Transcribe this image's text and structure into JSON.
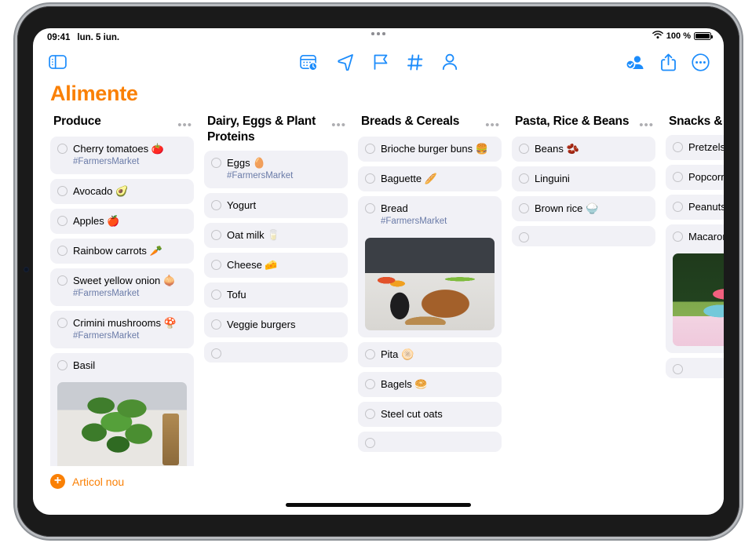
{
  "status_bar": {
    "time": "09:41",
    "date": "lun. 5 iun.",
    "wifi_icon": "wifi-icon",
    "battery_percent": "100 %"
  },
  "toolbar": {
    "sidebar_toggle": "sidebar-toggle-icon",
    "center_icons": [
      "calendar-clock-icon",
      "navigation-arrow-icon",
      "flag-icon",
      "hashtag-icon",
      "person-icon"
    ],
    "right_icons": [
      "add-collaborator-icon",
      "share-icon",
      "more-options-icon"
    ]
  },
  "header": {
    "title": "Alimente"
  },
  "board": {
    "columns": [
      {
        "title": "Produce",
        "more_label": "•••",
        "items": [
          {
            "text": "Cherry tomatoes 🍅",
            "tag": "#FarmersMarket"
          },
          {
            "text": "Avocado 🥑"
          },
          {
            "text": "Apples 🍎"
          },
          {
            "text": "Rainbow carrots 🥕"
          },
          {
            "text": "Sweet yellow onion 🧅",
            "tag": "#FarmersMarket"
          },
          {
            "text": "Crimini mushrooms 🍄",
            "tag": "#FarmersMarket"
          },
          {
            "text": "Basil",
            "photo": "basil"
          },
          {
            "text": "",
            "empty": true
          }
        ]
      },
      {
        "title": "Dairy, Eggs & Plant Proteins",
        "more_label": "•••",
        "items": [
          {
            "text": "Eggs 🥚",
            "tag": "#FarmersMarket"
          },
          {
            "text": "Yogurt"
          },
          {
            "text": "Oat milk 🥛"
          },
          {
            "text": "Cheese 🧀"
          },
          {
            "text": "Tofu"
          },
          {
            "text": "Veggie burgers"
          },
          {
            "text": "",
            "empty": true
          }
        ]
      },
      {
        "title": "Breads & Cereals",
        "more_label": "•••",
        "items": [
          {
            "text": "Brioche burger buns 🍔"
          },
          {
            "text": "Baguette 🥖"
          },
          {
            "text": "Bread",
            "tag": "#FarmersMarket",
            "photo": "bread"
          },
          {
            "text": "Pita 🫓"
          },
          {
            "text": "Bagels 🥯"
          },
          {
            "text": "Steel cut oats"
          },
          {
            "text": "",
            "empty": true
          }
        ]
      },
      {
        "title": "Pasta, Rice & Beans",
        "more_label": "•••",
        "items": [
          {
            "text": "Beans 🫘"
          },
          {
            "text": "Linguini"
          },
          {
            "text": "Brown rice 🍚"
          },
          {
            "text": "",
            "empty": true
          }
        ]
      },
      {
        "title": "Snacks & Candy",
        "more_label": "",
        "items": [
          {
            "text": "Pretzels 🥨"
          },
          {
            "text": "Popcorn 🍿"
          },
          {
            "text": "Peanuts 🥜"
          },
          {
            "text": "Macarons",
            "photo": "macaron"
          },
          {
            "text": "",
            "empty": true
          }
        ]
      }
    ]
  },
  "bottom_bar": {
    "new_item_label": "Articol nou",
    "plus_icon": "plus-circle-icon"
  },
  "colors": {
    "accent_orange": "#FA8005",
    "accent_blue": "#1C8CFB",
    "tag_blue": "#6A7BA8",
    "item_background": "#F1F1F6"
  }
}
